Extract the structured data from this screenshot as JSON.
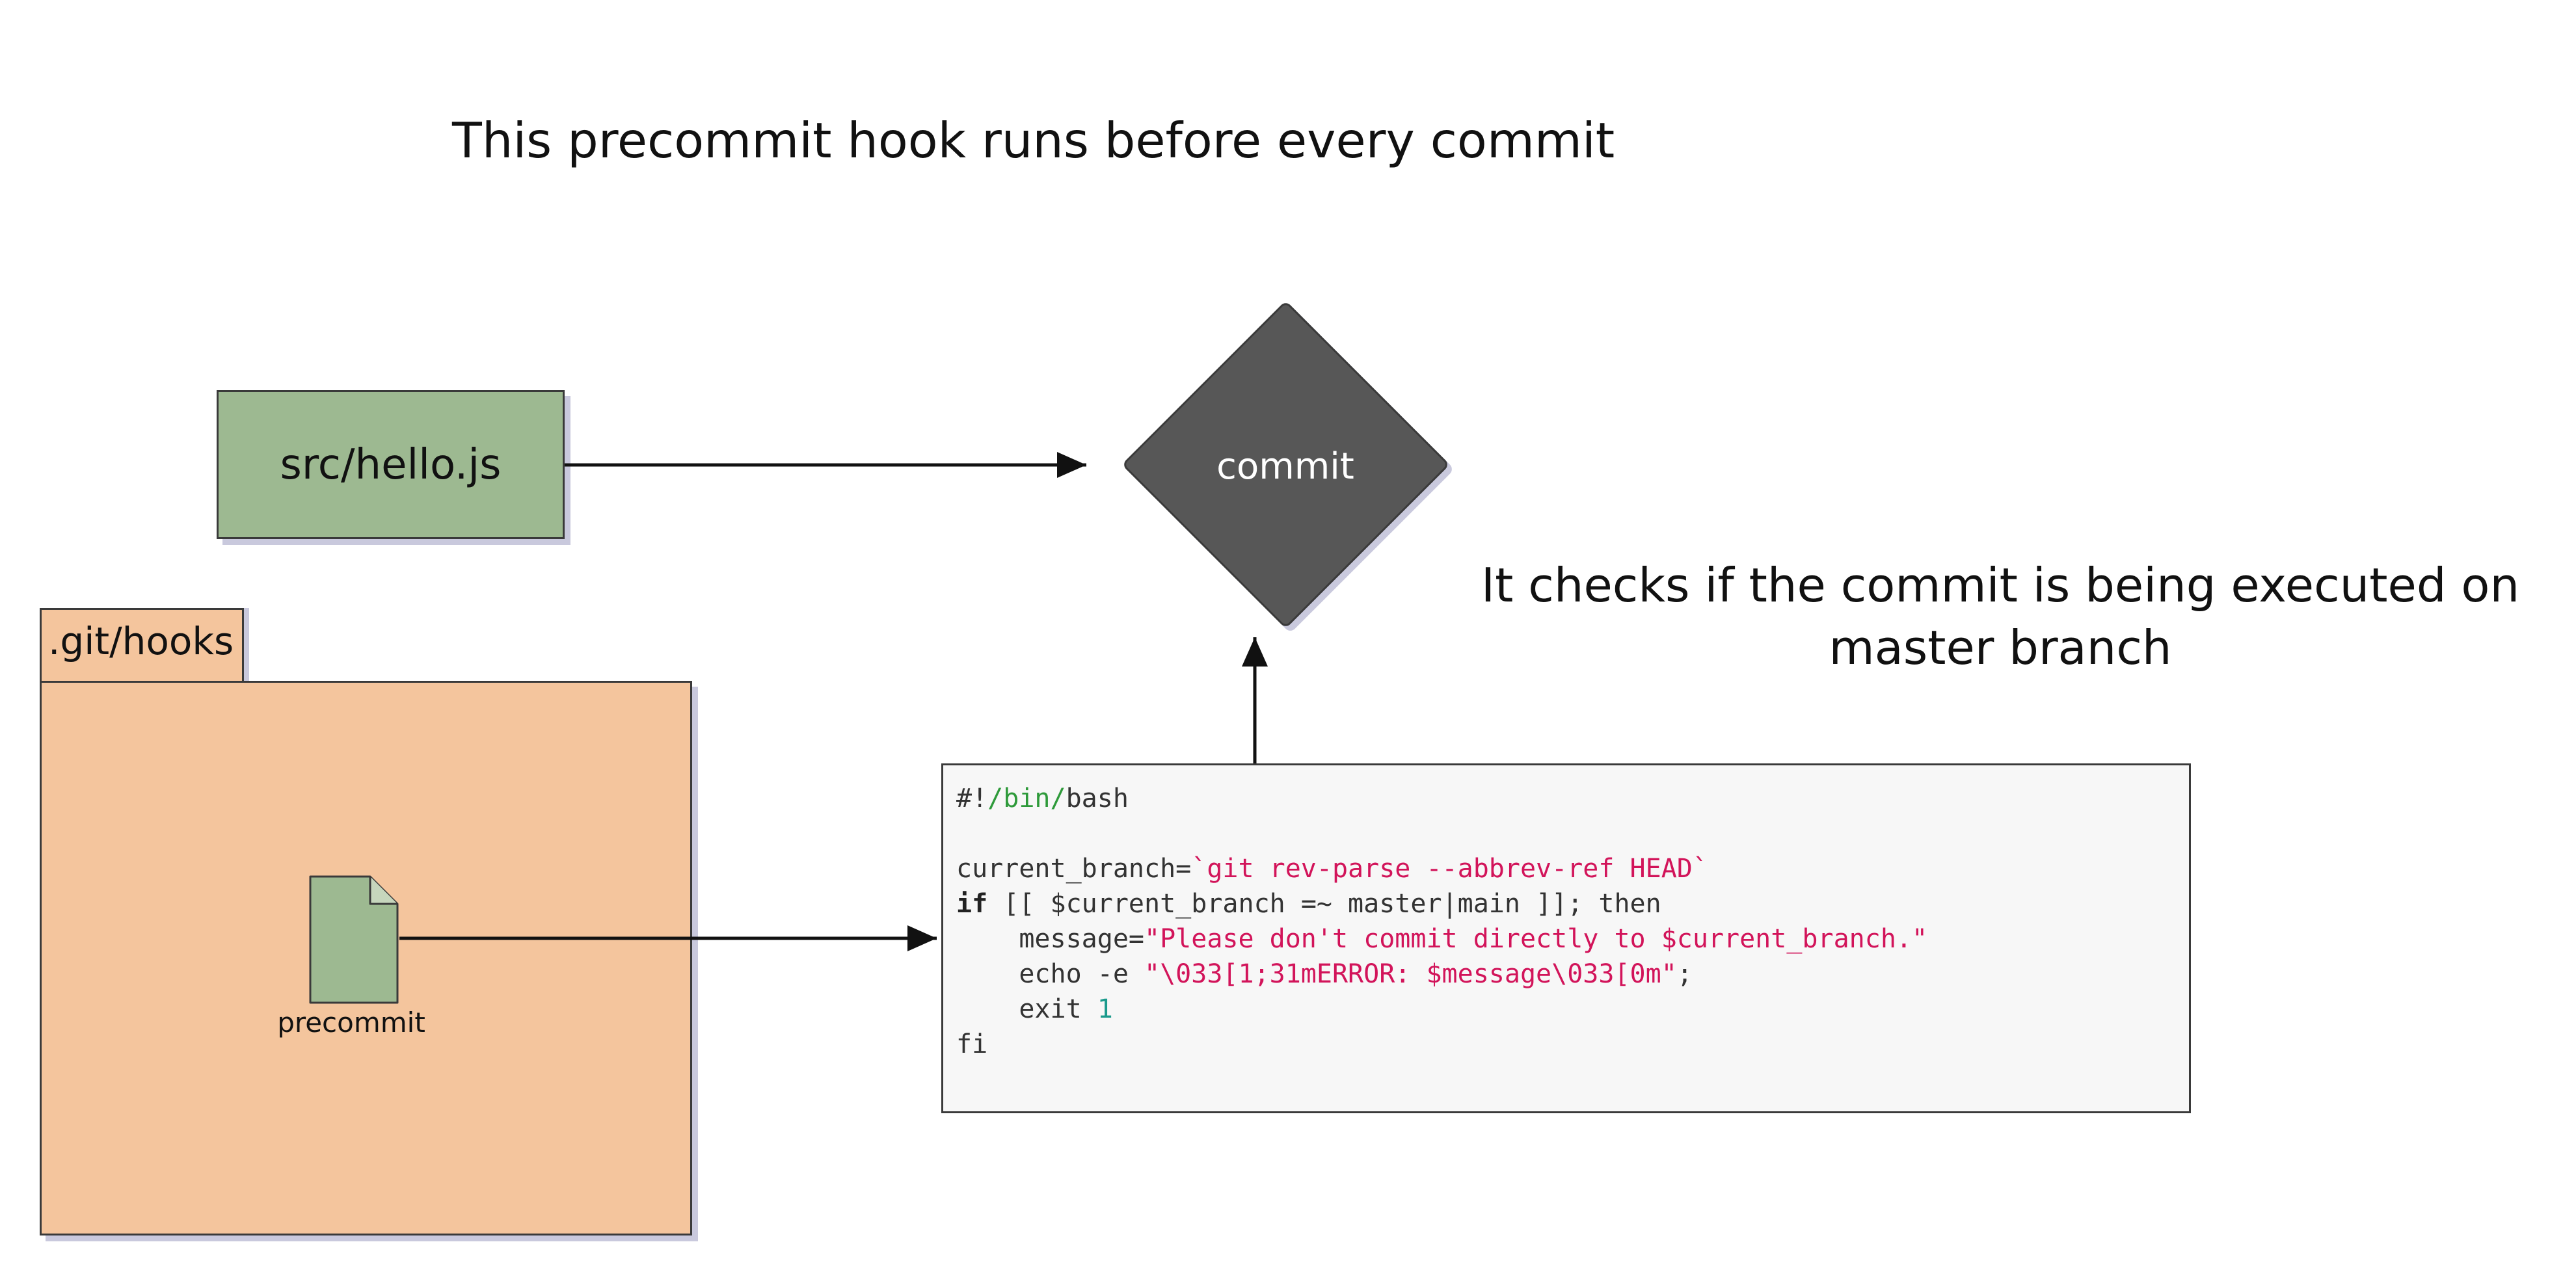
{
  "title": "This precommit hook runs before every commit",
  "file_node": {
    "label": "src/hello.js"
  },
  "commit_node": {
    "label": "commit"
  },
  "annotation": {
    "line1": "It checks if the commit is being executed on",
    "line2": "master branch"
  },
  "folder": {
    "label": ".git/hooks"
  },
  "hook_file": {
    "label": "precommit"
  },
  "code": {
    "lines": [
      [
        {
          "t": "#!"
        },
        {
          "t": "/bin/",
          "c": "green"
        },
        {
          "t": "bash"
        }
      ],
      [],
      [
        {
          "t": "current_branch="
        },
        {
          "t": "`git rev-parse --abbrev-ref HEAD`",
          "c": "red"
        }
      ],
      [
        {
          "t": "if",
          "c": "bold"
        },
        {
          "t": " [[ $current_branch =~ master|main ]]; then"
        }
      ],
      [
        {
          "t": "    message="
        },
        {
          "t": "\"Please don't commit directly to $current_branch.\"",
          "c": "red"
        }
      ],
      [
        {
          "t": "    echo -e "
        },
        {
          "t": "\"\\033[1;31mERROR: $message\\033[0m\"",
          "c": "red"
        },
        {
          "t": ";"
        }
      ],
      [
        {
          "t": "    exit "
        },
        {
          "t": "1",
          "c": "teal"
        }
      ],
      [
        {
          "t": "fi"
        }
      ]
    ]
  },
  "colors": {
    "file_fill": "#9db991",
    "commit_fill": "#575757",
    "folder_fill": "#f4c59d",
    "code_bg": "#f7f7f7",
    "string": "#d2145a",
    "path": "#2e9a3a",
    "number": "#1a9a8c"
  }
}
